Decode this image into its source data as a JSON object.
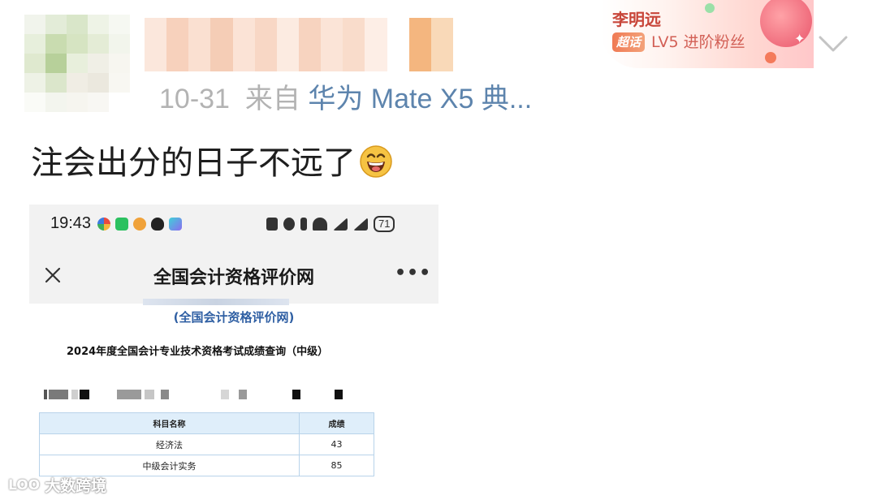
{
  "post": {
    "timestamp": "10-31",
    "source_prefix": "来自",
    "device": "华为 Mate X5 典...",
    "text": "注会出分的日子不远了",
    "emoji": "laughing-face-emoji"
  },
  "badge": {
    "name": "李明远",
    "tag": "超话",
    "level": "LV5 进阶粉丝"
  },
  "screenshot": {
    "status_bar": {
      "time": "19:43",
      "battery": "71"
    },
    "nav": {
      "title": "全国会计资格评价网",
      "more": "•••"
    },
    "doc": {
      "site": "(全国会计资格评价网)",
      "heading": "2024年度全国会计专业技术资格考试成绩查询（中级）"
    },
    "table": {
      "headers": [
        "科目名称",
        "成绩"
      ],
      "rows": [
        [
          "经济法",
          "43"
        ],
        [
          "中级会计实务",
          "85"
        ]
      ]
    }
  },
  "watermark": {
    "logo": "LOO",
    "text": "大数跨境"
  },
  "colors": {
    "device_link": "#5d84ad",
    "meta_gray": "#b3b3b3",
    "badge_red": "#c8463a",
    "site_blue": "#2f5fa3"
  }
}
